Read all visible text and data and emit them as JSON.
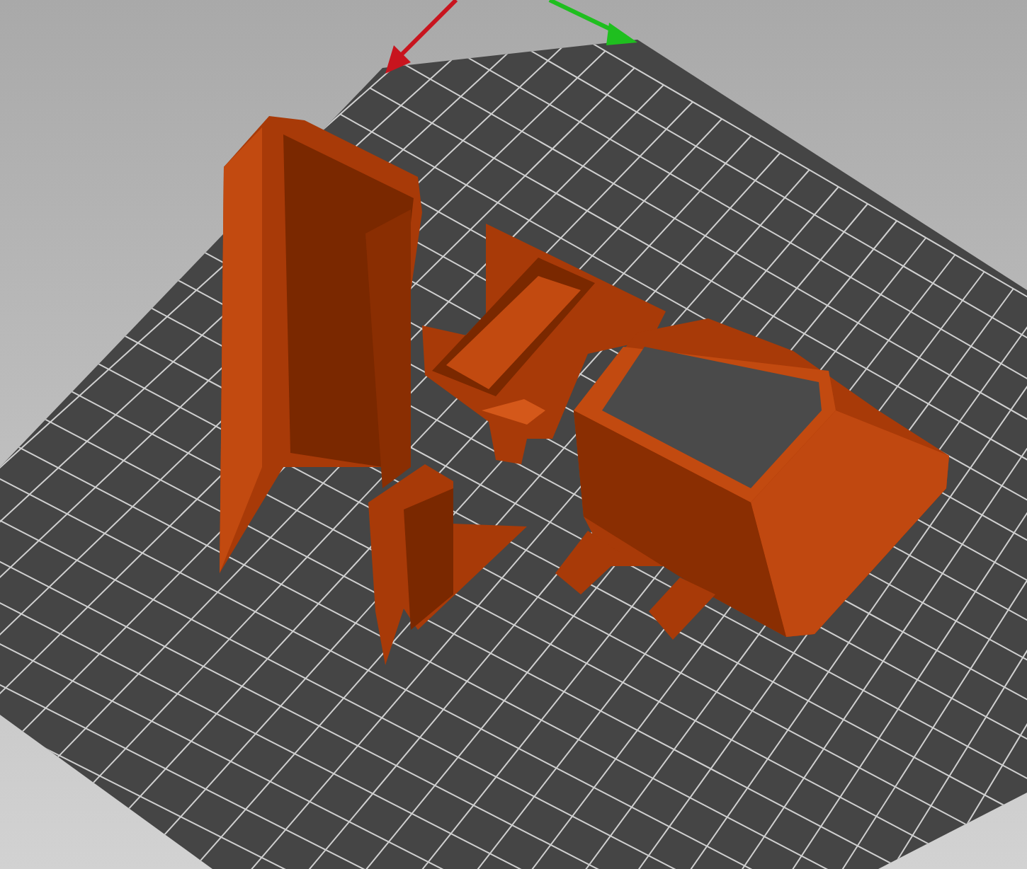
{
  "scene": {
    "kind": "print-bed"
  }
}
